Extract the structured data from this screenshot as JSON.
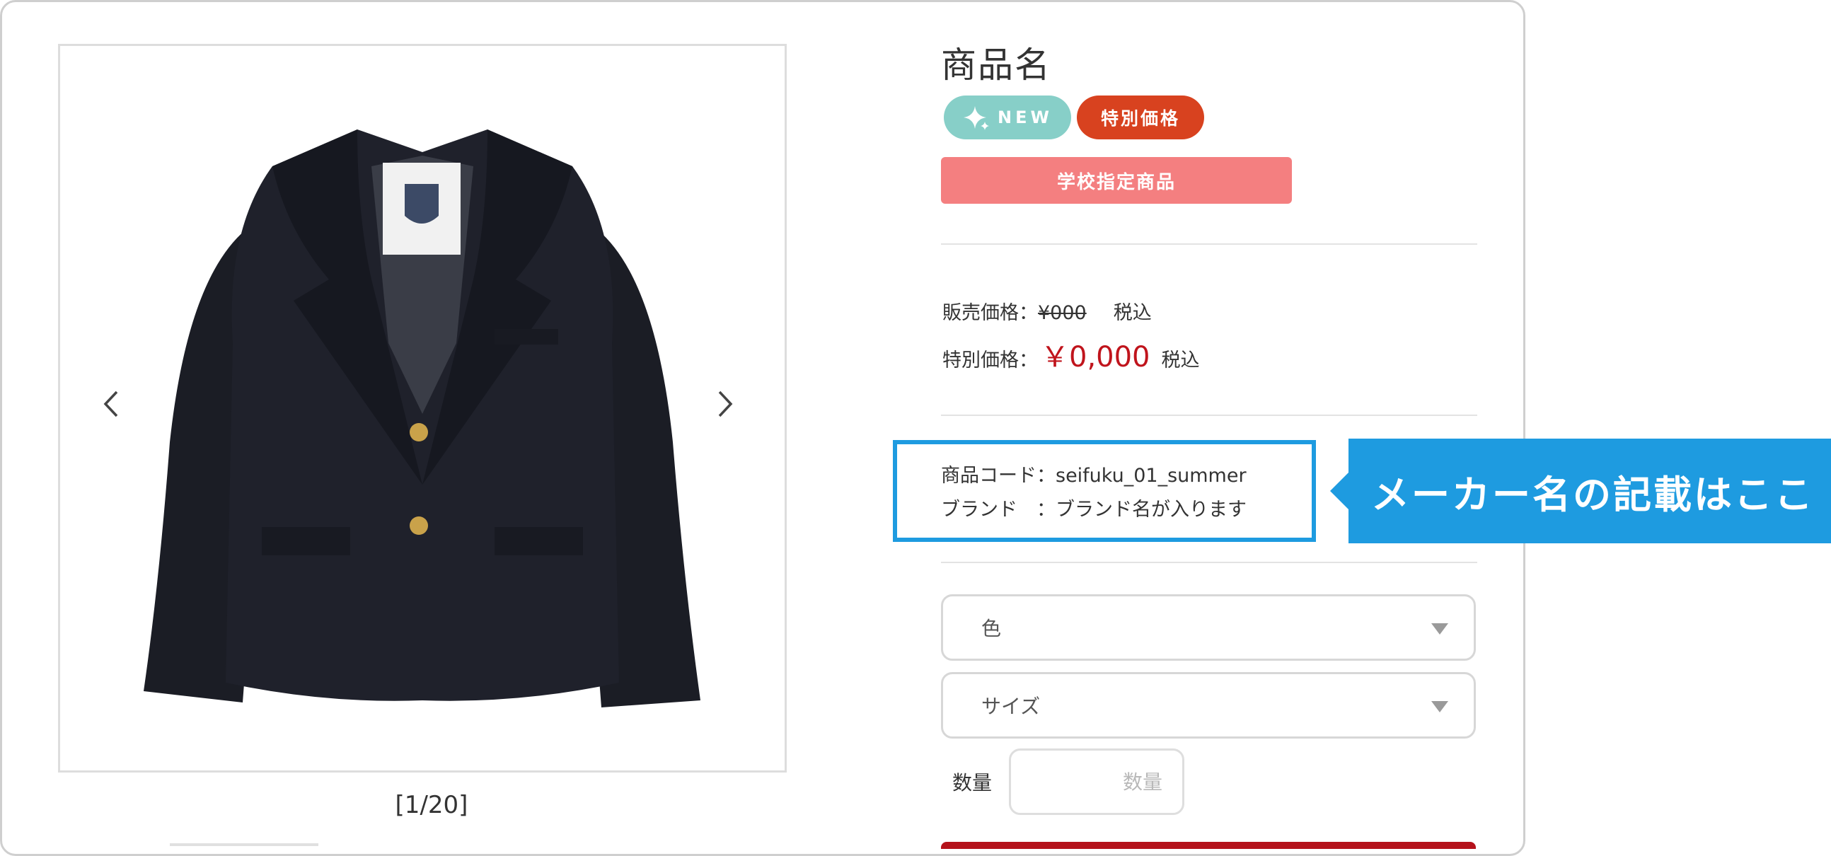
{
  "gallery": {
    "counter": "[1/20]",
    "prev_icon": "chevron-left-icon",
    "next_icon": "chevron-right-icon",
    "image_alt": "navy blazer"
  },
  "product": {
    "title": "商品名",
    "badges": {
      "new": "NEW",
      "special": "特別価格"
    },
    "school_tag": "学校指定商品",
    "price": {
      "regular_label": "販売価格：",
      "regular_value": "¥000",
      "regular_tax": "税込",
      "special_label": "特別価格：",
      "special_value": "￥0,000",
      "special_tax": "税込"
    },
    "meta": {
      "code_line": "商品コード：seifuku_01_summer",
      "brand_line": "ブランド　：ブランド名が入ります"
    },
    "options": {
      "color": "色",
      "size": "サイズ"
    },
    "quantity": {
      "label": "数量",
      "placeholder": "数量"
    }
  },
  "annotation": {
    "callout": "メーカー名の記載はここ"
  },
  "colors": {
    "new_badge": "#87cfc8",
    "special_badge": "#d8421f",
    "school_bar": "#f47f80",
    "special_price": "#c0141c",
    "callout": "#1e9be0"
  }
}
